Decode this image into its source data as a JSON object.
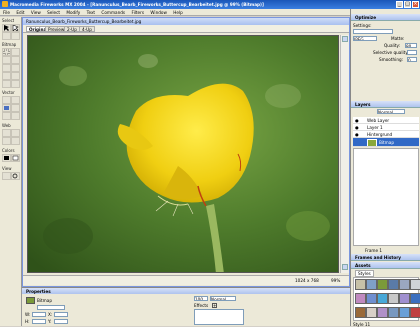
{
  "app": {
    "title": "Macromedia Fireworks MX 2004 - [Ranunculus_Bearb_Fireworks_Buttercup_Bearbeitet.jpg @ 99% (Bitmap)]",
    "window_buttons": [
      "_",
      "□",
      "×"
    ]
  },
  "menu": [
    "File",
    "Edit",
    "View",
    "Select",
    "Modify",
    "Text",
    "Commands",
    "Filters",
    "Window",
    "Help"
  ],
  "toolbox": {
    "sections": [
      "Select",
      "Bitmap",
      "Vector",
      "Web",
      "Colors",
      "View"
    ]
  },
  "document": {
    "title": "Ranunculus_Bearb_Fireworks_Buttercup_Bearbeitet.jpg",
    "tabs": [
      "Original",
      "Preview",
      "2-Up",
      "4-Up"
    ],
    "status_size": "1024 x 768",
    "zoom": "99%"
  },
  "properties": {
    "title": "Properties",
    "object_type": "Bitmap",
    "blend_mode": "Normal",
    "opacity": "100",
    "effects_label": "Effects",
    "w_label": "W:",
    "h_label": "H:",
    "x_label": "X:",
    "y_label": "Y:"
  },
  "optimize": {
    "title": "Optimize",
    "settings_label": "Settings:",
    "format": "JPEG",
    "matte_label": "Matte:",
    "quality_label": "Quality:",
    "quality_value": "80",
    "selective_label": "Selective quality:",
    "smoothing_label": "Smoothing:",
    "smoothing_value": "0"
  },
  "layers": {
    "title": "Layers",
    "blend": "Normal",
    "items": [
      "Web Layer",
      "Layer 1",
      "Hintergrund",
      "Bitmap"
    ],
    "frame_label": "Frame 1"
  },
  "frames_panel": {
    "title": "Frames and History"
  },
  "assets": {
    "title": "Assets",
    "tab": "Styles",
    "footer": "Style 11",
    "swatches": [
      "#c7c2a8",
      "#7fa0c8",
      "#7b9a3a",
      "#5a7ba8",
      "#9aa7c0",
      "#d0d4d8",
      "#c08ac0",
      "#6f8fd0",
      "#48a8d8",
      "#c9c9c9",
      "#a090d0",
      "#3b6fbf",
      "#9a6a3a",
      "#d8d0c8",
      "#b090c8",
      "#7898c0",
      "#6aa0d8",
      "#c04040"
    ]
  },
  "colors": {
    "title_blue": "#2a63c8",
    "panel": "#ece9d8",
    "petal": "#f2d515",
    "background_green": "#4d7a2a"
  }
}
